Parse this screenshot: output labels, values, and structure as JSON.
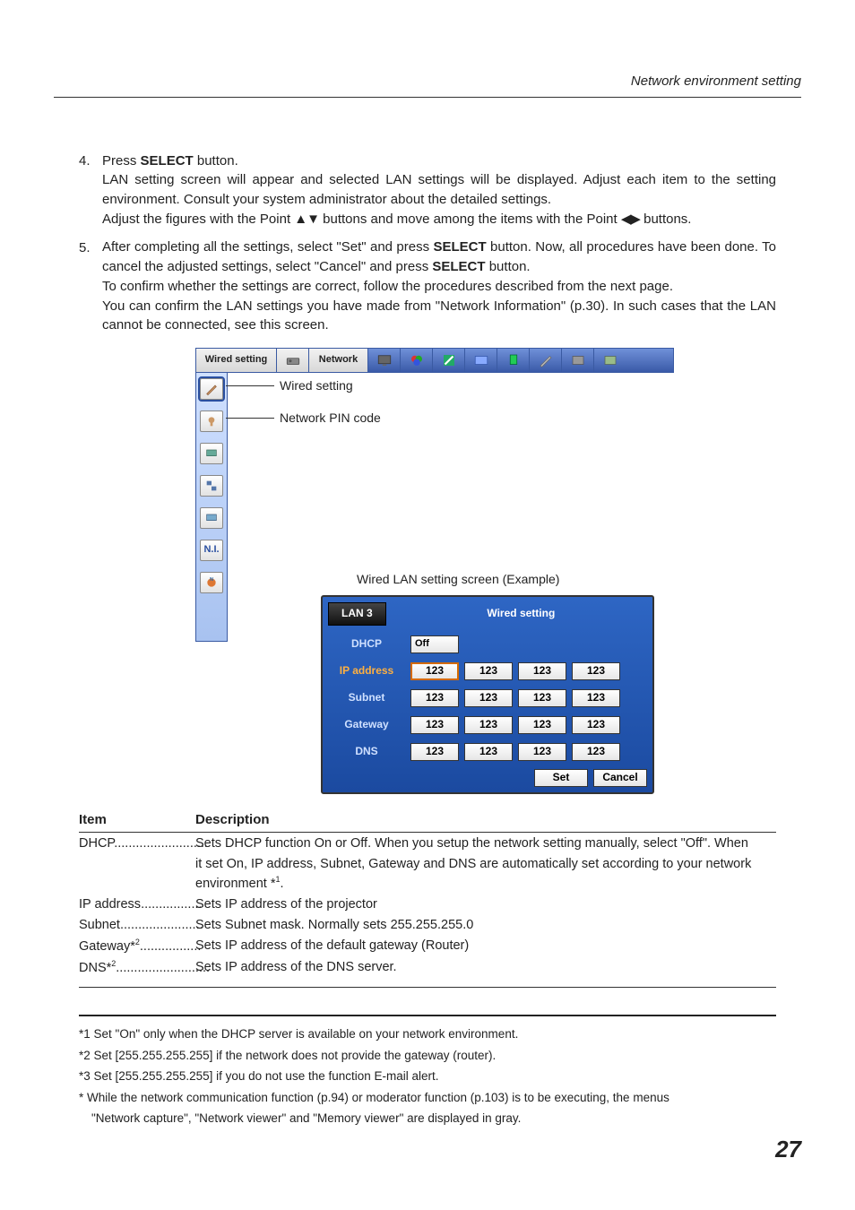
{
  "header": {
    "section_title": "Network environment setting"
  },
  "step4": {
    "num": "4.",
    "line1a": "Press ",
    "select_word": "SELECT",
    "line1b": " button.",
    "para1": "LAN setting screen will appear and selected LAN settings will be displayed. Adjust each item to the setting environment. Consult your system administrator about the detailed settings.",
    "para2a": "Adjust the figures with the Point ",
    "arrows_ud": "▲▼",
    "para2b": " buttons and move among the items with the Point ",
    "arrows_lr": "◀▶",
    "para2c": " buttons."
  },
  "step5": {
    "num": "5.",
    "p1a": "After completing all the settings, select \"Set\" and press ",
    "p1b": " button. Now, all procedures have been done. To cancel the adjusted settings, select \"Cancel\" and press ",
    "p1c": " button.",
    "p2": "To confirm whether the settings are correct, follow the procedures described from the next page.",
    "p3": "You can confirm the LAN settings you have made from \"Network Information\" (p.30). In such cases that the LAN cannot be connected, see this screen."
  },
  "menubar": {
    "tab": "Wired setting",
    "net": "Network"
  },
  "callouts": {
    "wired": "Wired setting",
    "pin": "Network PIN code"
  },
  "left_icons": {
    "ni": "N.I."
  },
  "example_caption": "Wired LAN setting screen (Example)",
  "dialog": {
    "lan_tag": "LAN 3",
    "title": "Wired setting",
    "rows": {
      "dhcp": "DHCP",
      "ip": "IP address",
      "subnet": "Subnet",
      "gateway": "Gateway",
      "dns": "DNS"
    },
    "off": "Off",
    "oct": "123",
    "set": "Set",
    "cancel": "Cancel"
  },
  "table": {
    "h1": "Item",
    "h2": "Description",
    "dhcp_item": "DHCP",
    "dhcp_desc1": "Sets DHCP function On or Off. When you setup the network setting manually, select \"Off\". When",
    "dhcp_desc2": "it set On, IP address, Subnet, Gateway  and DNS are automatically set according to your network environment *",
    "dhcp_sup": "1",
    "dhcp_desc3": ".",
    "ip_item": "IP address",
    "ip_dots": ".................",
    "ip_desc": "Sets IP address of the projector",
    "sub_item": "Subnet",
    "sub_dots": ".......................",
    "sub_desc": "Sets Subnet mask. Normally sets 255.255.255.0",
    "gw_item": "Gateway*",
    "gw_sup": "2",
    "gw_dots": ".................",
    "gw_desc": "Sets IP address of the default gateway (Router)",
    "dns_item": "DNS*",
    "dns_sup": "2",
    "dns_dots": "..........................",
    "dns_desc": "Sets IP address of the DNS server.",
    "dhcp_dots": ".........................."
  },
  "footnotes": {
    "f1": "*1 Set \"On\" only when the DHCP server is available on your network environment.",
    "f2": "*2 Set [255.255.255.255] if the network does not provide the gateway (router).",
    "f3": "*3 Set [255.255.255.255] if you do not use the function E-mail alert.",
    "f4a": "* While the network communication function (p.94) or moderator function (p.103) is to be executing, the menus",
    "f4b": "\"Network capture\", \"Network viewer\" and \"Memory viewer\" are displayed in gray."
  },
  "page_number": "27"
}
